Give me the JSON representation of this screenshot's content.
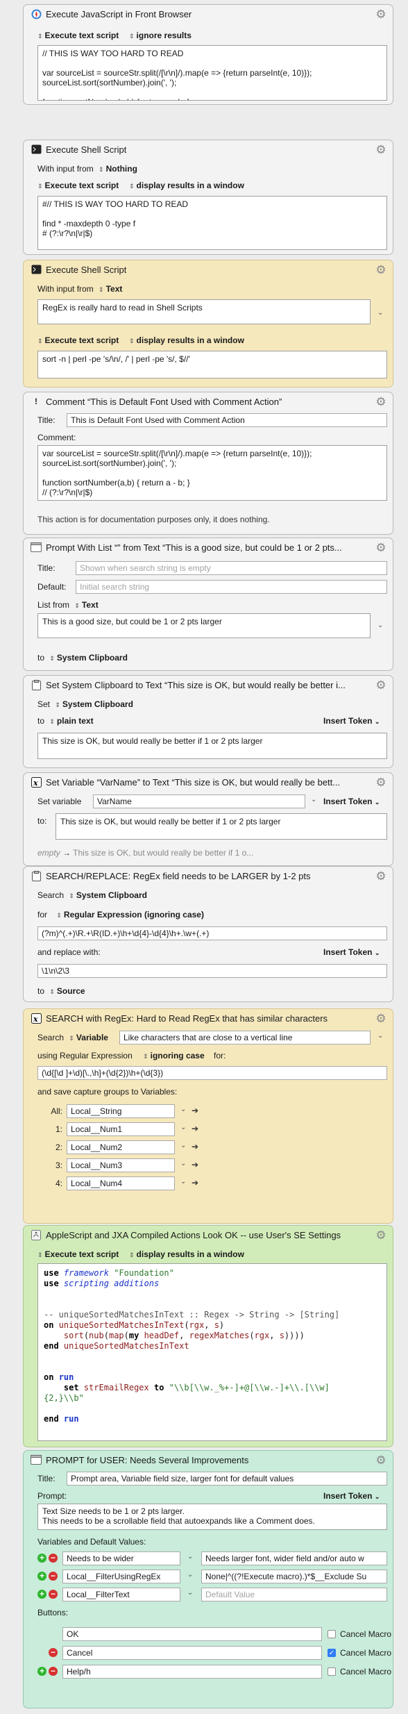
{
  "a1": {
    "title": "Execute JavaScript in Front Browser",
    "opt1": "Execute text script",
    "opt2": "ignore results",
    "code": "// THIS IS WAY TOO HARD TO READ\n\nvar sourceList = sourceStr.split(/[\\r\\n]/).map(e => {return parseInt(e, 10)});\nsourceList.sort(sortNumber).join(', ');\n\nfunction sortNumber(a,b) { return a - b; }\n// (?:\\r?\\n|\\r|$)"
  },
  "a2": {
    "title": "Execute Shell Script",
    "input_label": "With input from",
    "input_value": "Nothing",
    "opt1": "Execute text script",
    "opt2": "display results in a window",
    "code": "#// THIS IS WAY TOO HARD TO READ\n\nfind * -maxdepth 0 -type f\n# (?:\\r?\\n|\\r|$)"
  },
  "a3": {
    "title": "Execute Shell Script",
    "input_label": "With input from",
    "input_value": "Text",
    "text": "RegEx is really hard to read in Shell Scripts",
    "opt1": "Execute text script",
    "opt2": "display results in a window",
    "code": "sort -n | perl -pe 's/\\n/, /' | perl -pe 's/, $//'"
  },
  "a4": {
    "title": "Comment “This is Default Font Used with Comment Action”",
    "title_label": "Title:",
    "title_value": "This is Default Font Used with Comment Action",
    "comment_label": "Comment:",
    "comment": "var sourceList = sourceStr.split(/[\\r\\n]/).map(e => {return parseInt(e, 10)});\nsourceList.sort(sortNumber).join(', ');\n\nfunction sortNumber(a,b) { return a - b; }\n// (?:\\r?\\n|\\r|$)",
    "note": "This action is for documentation purposes only, it does nothing."
  },
  "a5": {
    "title": "Prompt With List “” from Text “This is a good size, but could be 1 or 2 pts...",
    "title_label": "Title:",
    "title_placeholder": "Shown when search string is empty",
    "default_label": "Default:",
    "default_placeholder": "Initial search string",
    "list_label": "List from",
    "list_value": "Text",
    "text": "This is a good size, but could be 1 or 2 pts larger",
    "to_label": "to",
    "to_value": "System Clipboard"
  },
  "a6": {
    "title": "Set System Clipboard to Text “This size is OK, but would really be better i...",
    "set_label": "Set",
    "set_value": "System Clipboard",
    "to_label": "to",
    "to_value": "plain text",
    "insert_token": "Insert Token",
    "text": "This size is OK, but would really be better if 1 or 2 pts larger"
  },
  "a7": {
    "title": "Set Variable “VarName” to Text “This size is OK, but would really be bett...",
    "set_label": "Set variable",
    "var_name": "VarName",
    "insert_token": "Insert Token",
    "to_label": "to:",
    "text": "This size is OK, but would really be better if 1 or 2 pts larger",
    "preview_empty": "empty",
    "preview_arrow": "→",
    "preview_text": "This size is OK, but would really be better if 1 o..."
  },
  "a8": {
    "title": "SEARCH/REPLACE:  RegEx field needs to be LARGER by 1-2 pts",
    "search_label": "Search",
    "search_value": "System Clipboard",
    "for_label": "for",
    "for_value": "Regular Expression (ignoring case)",
    "regex": "(?m)^(.+)\\R.+\\R(ID.+)\\h+\\d{4}-\\d{4}\\h+.\\w+(.+)",
    "replace_label": "and replace with:",
    "insert_token": "Insert Token",
    "replace": "\\1\\n\\2\\3",
    "to_label": "to",
    "to_value": "Source"
  },
  "a9": {
    "title": "SEARCH with RegEx:  Hard to Read RegEx that has similar characters",
    "search_label": "Search",
    "search_value": "Variable",
    "var_value": "Like characters that are close to a vertical line",
    "using_label": "using Regular Expression",
    "case_value": "ignoring case",
    "for_label": "for:",
    "regex": "(\\d{[\\d ]+\\d)[\\.,\\h]+(\\d{2})\\h+(\\d{3})",
    "capture_label": "and save capture groups to Variables:",
    "groups": [
      {
        "label": "All:",
        "var": "Local__String"
      },
      {
        "label": "1:",
        "var": "Local__Num1"
      },
      {
        "label": "2:",
        "var": "Local__Num2"
      },
      {
        "label": "3:",
        "var": "Local__Num3"
      },
      {
        "label": "4:",
        "var": "Local__Num4"
      }
    ]
  },
  "a10": {
    "title": "AppleScript and JXA Compiled Actions Look OK -- use User's SE Settings",
    "opt1": "Execute text script",
    "opt2": "display results in a window"
  },
  "a11": {
    "title": "PROMPT for USER:  Needs Several Improvements",
    "title_label": "Title:",
    "title_value": "Prompt area, Variable field size, larger font for default values",
    "prompt_label": "Prompt:",
    "insert_token": "Insert Token",
    "prompt": "Text Size needs to be 1 or 2 pts larger.\nThis needs to be a scrollable field that autoexpands like a Comment does.",
    "vars_label": "Variables and Default Values:",
    "vars": [
      {
        "name": "Needs to be wider",
        "value": "Needs larger font, wider field and/or auto w"
      },
      {
        "name": "Local__FilterUsingRegEx",
        "value": "None|^((?!Execute macro).)*$__Exclude Su"
      },
      {
        "name": "Local__FilterText",
        "value": "",
        "placeholder": "Default Value"
      }
    ],
    "buttons_label": "Buttons:",
    "buttons": [
      {
        "name": "OK",
        "cancel": "Cancel Macro",
        "checked": false
      },
      {
        "name": "Cancel",
        "cancel": "Cancel Macro",
        "checked": true
      },
      {
        "name": "Help/h",
        "cancel": "Cancel Macro",
        "checked": false
      }
    ]
  }
}
